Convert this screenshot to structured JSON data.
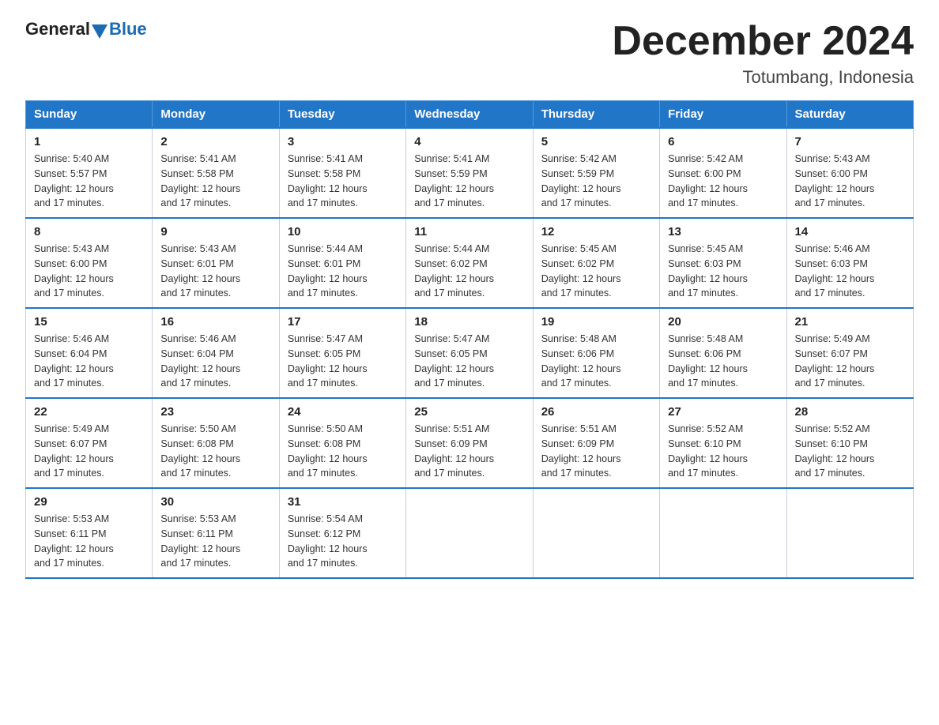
{
  "header": {
    "logo_general": "General",
    "logo_blue": "Blue",
    "month_title": "December 2024",
    "location": "Totumbang, Indonesia"
  },
  "days_of_week": [
    "Sunday",
    "Monday",
    "Tuesday",
    "Wednesday",
    "Thursday",
    "Friday",
    "Saturday"
  ],
  "weeks": [
    [
      {
        "day": "1",
        "sunrise": "5:40 AM",
        "sunset": "5:57 PM",
        "daylight": "12 hours and 17 minutes."
      },
      {
        "day": "2",
        "sunrise": "5:41 AM",
        "sunset": "5:58 PM",
        "daylight": "12 hours and 17 minutes."
      },
      {
        "day": "3",
        "sunrise": "5:41 AM",
        "sunset": "5:58 PM",
        "daylight": "12 hours and 17 minutes."
      },
      {
        "day": "4",
        "sunrise": "5:41 AM",
        "sunset": "5:59 PM",
        "daylight": "12 hours and 17 minutes."
      },
      {
        "day": "5",
        "sunrise": "5:42 AM",
        "sunset": "5:59 PM",
        "daylight": "12 hours and 17 minutes."
      },
      {
        "day": "6",
        "sunrise": "5:42 AM",
        "sunset": "6:00 PM",
        "daylight": "12 hours and 17 minutes."
      },
      {
        "day": "7",
        "sunrise": "5:43 AM",
        "sunset": "6:00 PM",
        "daylight": "12 hours and 17 minutes."
      }
    ],
    [
      {
        "day": "8",
        "sunrise": "5:43 AM",
        "sunset": "6:00 PM",
        "daylight": "12 hours and 17 minutes."
      },
      {
        "day": "9",
        "sunrise": "5:43 AM",
        "sunset": "6:01 PM",
        "daylight": "12 hours and 17 minutes."
      },
      {
        "day": "10",
        "sunrise": "5:44 AM",
        "sunset": "6:01 PM",
        "daylight": "12 hours and 17 minutes."
      },
      {
        "day": "11",
        "sunrise": "5:44 AM",
        "sunset": "6:02 PM",
        "daylight": "12 hours and 17 minutes."
      },
      {
        "day": "12",
        "sunrise": "5:45 AM",
        "sunset": "6:02 PM",
        "daylight": "12 hours and 17 minutes."
      },
      {
        "day": "13",
        "sunrise": "5:45 AM",
        "sunset": "6:03 PM",
        "daylight": "12 hours and 17 minutes."
      },
      {
        "day": "14",
        "sunrise": "5:46 AM",
        "sunset": "6:03 PM",
        "daylight": "12 hours and 17 minutes."
      }
    ],
    [
      {
        "day": "15",
        "sunrise": "5:46 AM",
        "sunset": "6:04 PM",
        "daylight": "12 hours and 17 minutes."
      },
      {
        "day": "16",
        "sunrise": "5:46 AM",
        "sunset": "6:04 PM",
        "daylight": "12 hours and 17 minutes."
      },
      {
        "day": "17",
        "sunrise": "5:47 AM",
        "sunset": "6:05 PM",
        "daylight": "12 hours and 17 minutes."
      },
      {
        "day": "18",
        "sunrise": "5:47 AM",
        "sunset": "6:05 PM",
        "daylight": "12 hours and 17 minutes."
      },
      {
        "day": "19",
        "sunrise": "5:48 AM",
        "sunset": "6:06 PM",
        "daylight": "12 hours and 17 minutes."
      },
      {
        "day": "20",
        "sunrise": "5:48 AM",
        "sunset": "6:06 PM",
        "daylight": "12 hours and 17 minutes."
      },
      {
        "day": "21",
        "sunrise": "5:49 AM",
        "sunset": "6:07 PM",
        "daylight": "12 hours and 17 minutes."
      }
    ],
    [
      {
        "day": "22",
        "sunrise": "5:49 AM",
        "sunset": "6:07 PM",
        "daylight": "12 hours and 17 minutes."
      },
      {
        "day": "23",
        "sunrise": "5:50 AM",
        "sunset": "6:08 PM",
        "daylight": "12 hours and 17 minutes."
      },
      {
        "day": "24",
        "sunrise": "5:50 AM",
        "sunset": "6:08 PM",
        "daylight": "12 hours and 17 minutes."
      },
      {
        "day": "25",
        "sunrise": "5:51 AM",
        "sunset": "6:09 PM",
        "daylight": "12 hours and 17 minutes."
      },
      {
        "day": "26",
        "sunrise": "5:51 AM",
        "sunset": "6:09 PM",
        "daylight": "12 hours and 17 minutes."
      },
      {
        "day": "27",
        "sunrise": "5:52 AM",
        "sunset": "6:10 PM",
        "daylight": "12 hours and 17 minutes."
      },
      {
        "day": "28",
        "sunrise": "5:52 AM",
        "sunset": "6:10 PM",
        "daylight": "12 hours and 17 minutes."
      }
    ],
    [
      {
        "day": "29",
        "sunrise": "5:53 AM",
        "sunset": "6:11 PM",
        "daylight": "12 hours and 17 minutes."
      },
      {
        "day": "30",
        "sunrise": "5:53 AM",
        "sunset": "6:11 PM",
        "daylight": "12 hours and 17 minutes."
      },
      {
        "day": "31",
        "sunrise": "5:54 AM",
        "sunset": "6:12 PM",
        "daylight": "12 hours and 17 minutes."
      },
      null,
      null,
      null,
      null
    ]
  ]
}
